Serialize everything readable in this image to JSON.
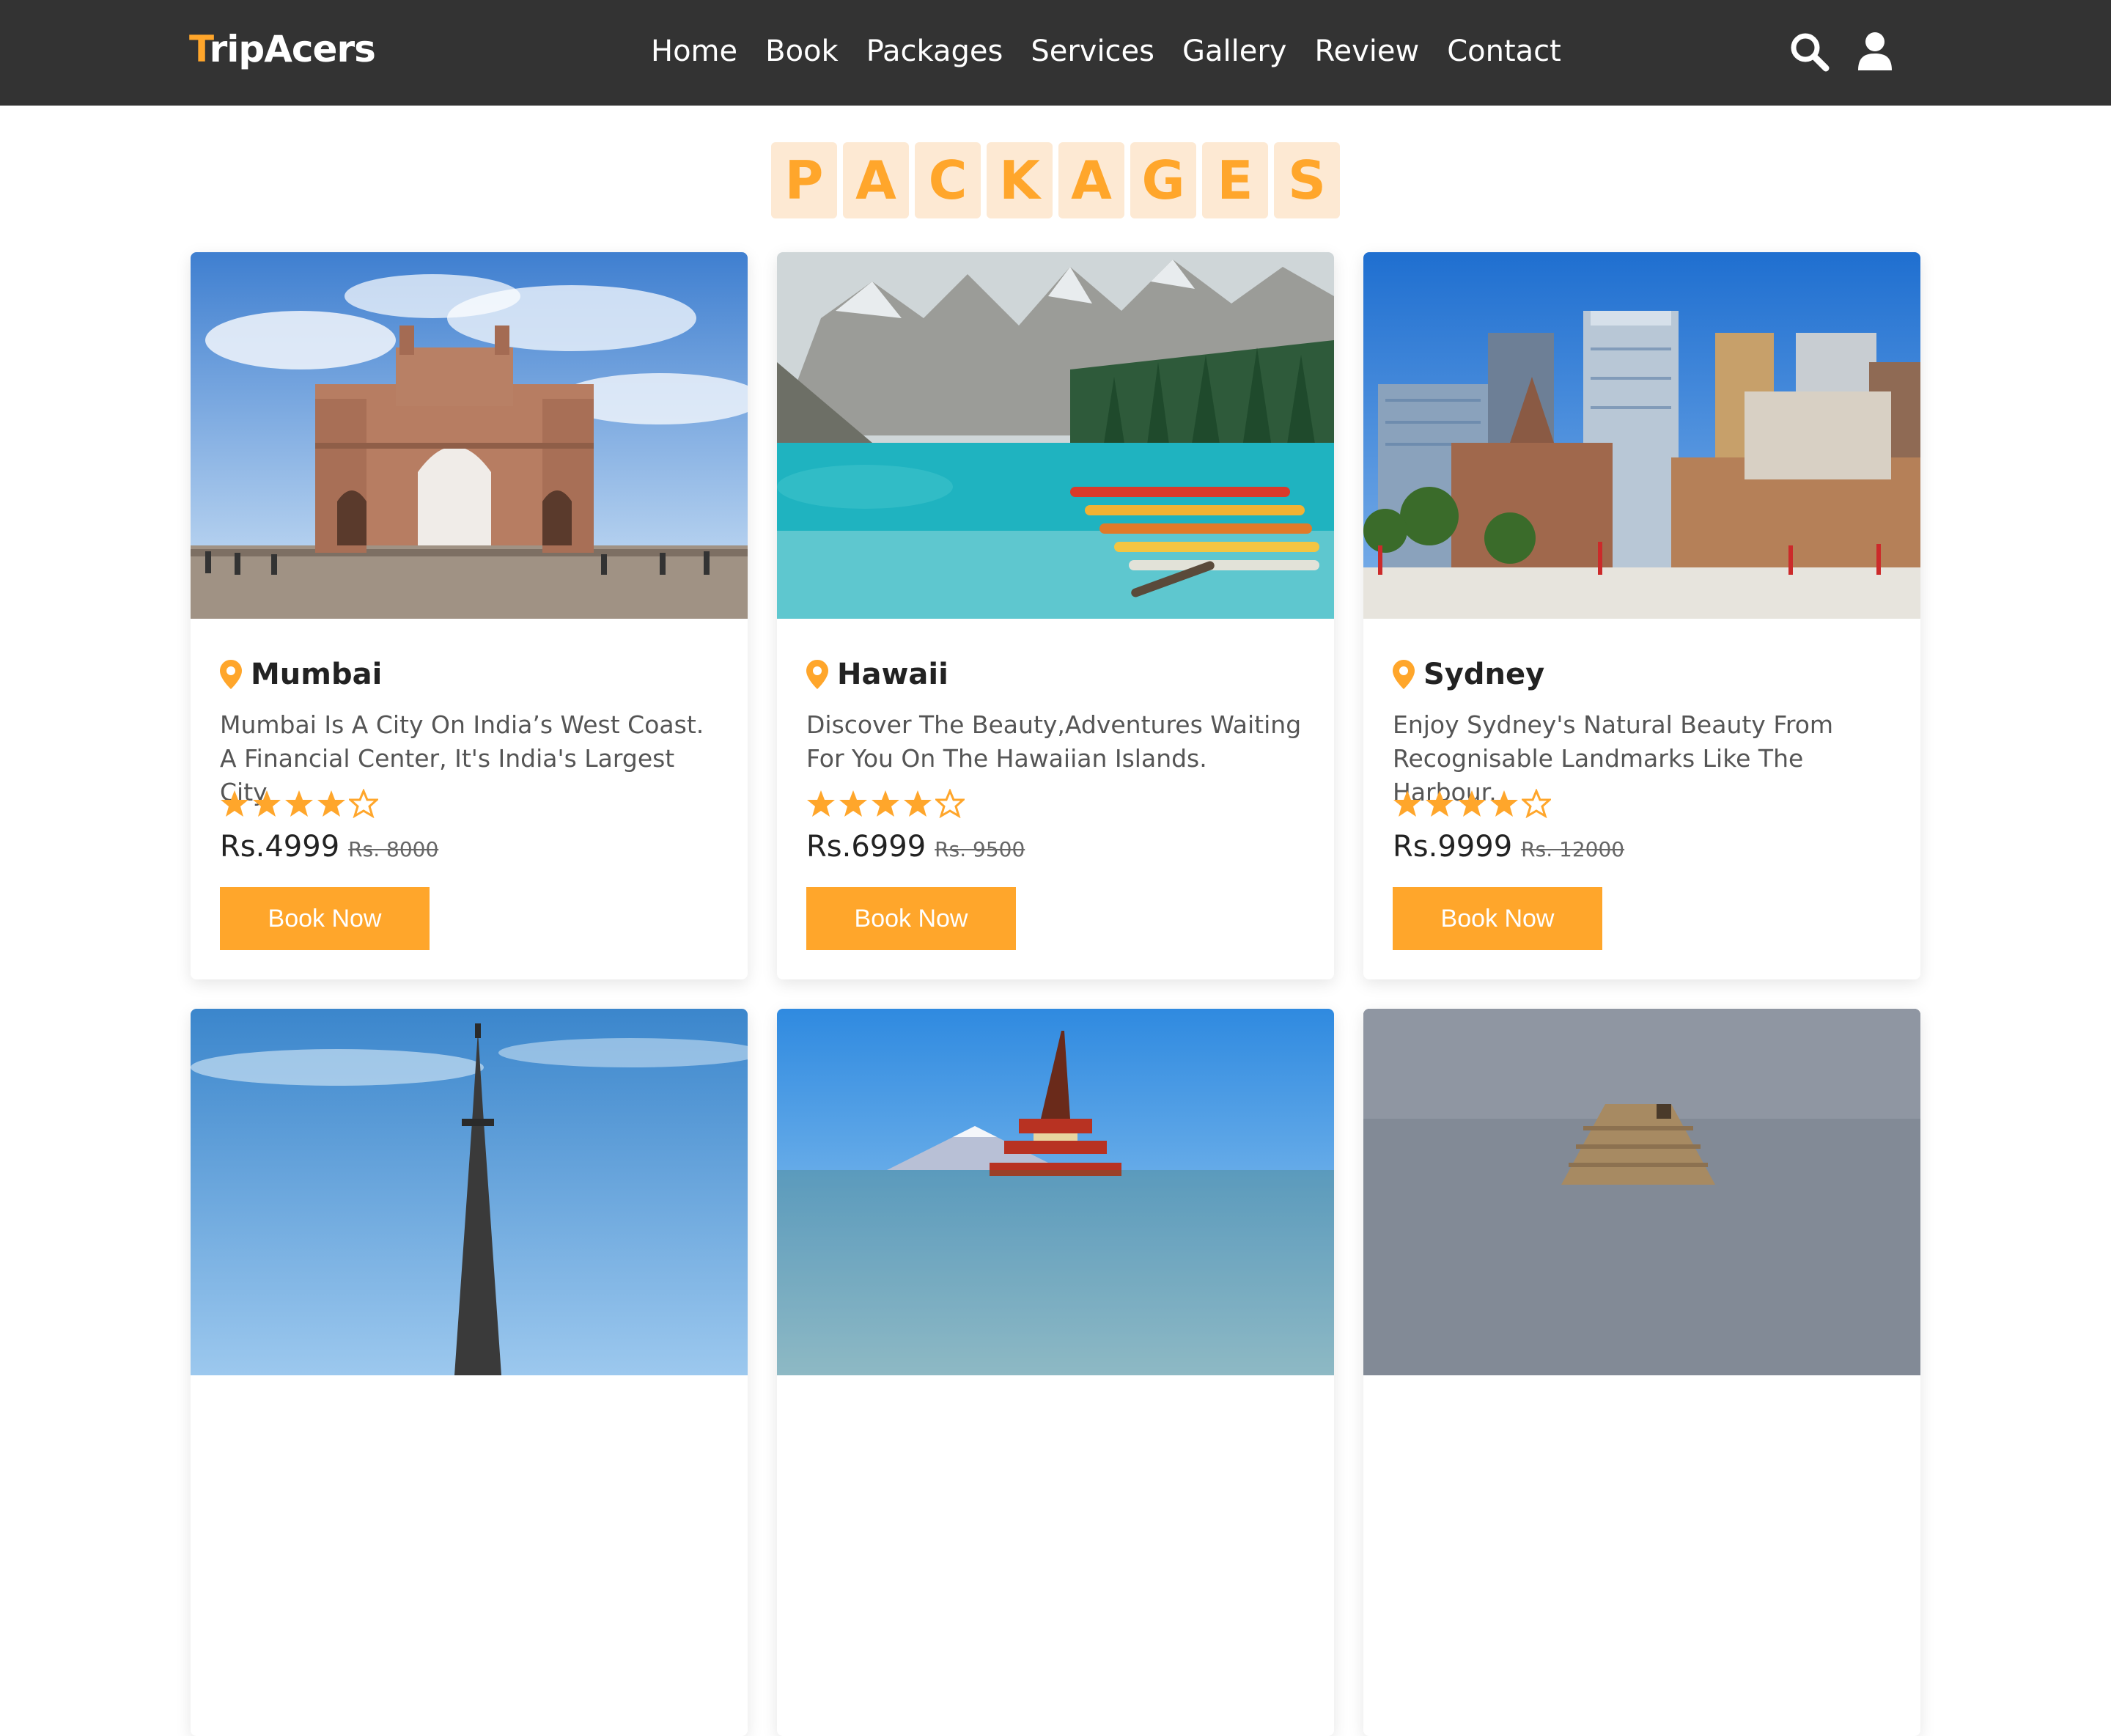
{
  "header": {
    "logo_first": "T",
    "logo_rest": "ripAcers",
    "nav": [
      "Home",
      "Book",
      "Packages",
      "Services",
      "Gallery",
      "Review",
      "Contact"
    ],
    "icons": [
      "search-icon",
      "user-icon"
    ]
  },
  "heading": {
    "letters": [
      "P",
      "A",
      "C",
      "K",
      "A",
      "G",
      "E",
      "S"
    ]
  },
  "colors": {
    "accent": "#ffa62b",
    "header_bg": "#333333",
    "heading_tile": "#fde9d3"
  },
  "packages": [
    {
      "name": "Mumbai",
      "description": "Mumbai Is A City On India’s West Coast. A Financial Center, It's India's Largest City.",
      "rating": 4,
      "rating_max": 5,
      "price": "Rs.4999",
      "old_price": "Rs. 8000",
      "button": "Book Now"
    },
    {
      "name": "Hawaii",
      "description": "Discover The Beauty,Adventures Waiting For You On The Hawaiian Islands.",
      "rating": 4,
      "rating_max": 5,
      "price": "Rs.6999",
      "old_price": "Rs. 9500",
      "button": "Book Now"
    },
    {
      "name": "Sydney",
      "description": "Enjoy Sydney's Natural Beauty From Recognisable Landmarks Like The Harbour.",
      "rating": 4,
      "rating_max": 5,
      "price": "Rs.9999",
      "old_price": "Rs. 12000",
      "button": "Book Now"
    }
  ]
}
